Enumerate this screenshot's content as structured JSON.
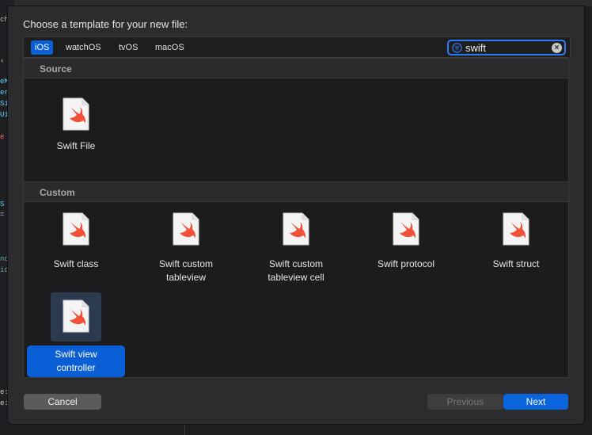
{
  "dialog": {
    "title": "Choose a template for your new file:"
  },
  "platform_tabs": [
    {
      "label": "iOS",
      "selected": true
    },
    {
      "label": "watchOS",
      "selected": false
    },
    {
      "label": "tvOS",
      "selected": false
    },
    {
      "label": "macOS",
      "selected": false
    }
  ],
  "search": {
    "value": "swift",
    "icon": "filter-icon",
    "clear_icon": "clear-search-icon"
  },
  "sections": [
    {
      "header": "Source",
      "templates": [
        {
          "label": "Swift File",
          "icon": "swift-file-icon"
        }
      ]
    },
    {
      "header": "Custom",
      "templates": [
        {
          "label": "Swift class",
          "icon": "swift-file-icon"
        },
        {
          "label": "Swift custom\ntableview",
          "icon": "swift-file-icon"
        },
        {
          "label": "Swift custom\ntableview cell",
          "icon": "swift-file-icon"
        },
        {
          "label": "Swift protocol",
          "icon": "swift-file-icon"
        },
        {
          "label": "Swift struct",
          "icon": "swift-file-icon"
        },
        {
          "label": "Swift view\ncontroller",
          "icon": "swift-file-icon",
          "selected": true
        }
      ]
    }
  ],
  "buttons": {
    "cancel": "Cancel",
    "previous": "Previous",
    "next": "Next"
  },
  "colors": {
    "accent": "#0a5fd6",
    "swift_orange": "#f05138",
    "sheet_bg": "#2c2c2e",
    "content_bg": "#1c1c1e"
  },
  "background_editor": {
    "top_label": "ch",
    "lines": [
      "eM",
      "er",
      "Si",
      "Ui",
      "e",
      "S",
      "=",
      "no",
      "ic",
      "e:",
      "e:"
    ]
  }
}
